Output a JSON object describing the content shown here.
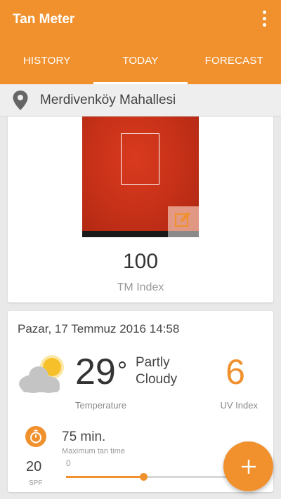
{
  "app": {
    "title": "Tan Meter"
  },
  "tabs": [
    {
      "label": "HISTORY",
      "active": false
    },
    {
      "label": "TODAY",
      "active": true
    },
    {
      "label": "FORECAST",
      "active": false
    }
  ],
  "location": {
    "name": "Merdivenköy Mahallesi",
    "icon": "location-pin-icon"
  },
  "measurement": {
    "tm_index": "100",
    "tm_index_label": "TM Index"
  },
  "weather": {
    "date": "Pazar, 17 Temmuz 2016 14:58",
    "icon": "partly-cloudy-icon",
    "temperature": "29",
    "temperature_unit": "°",
    "condition": "Partly Cloudy",
    "temperature_label": "Temperature",
    "uv_index": "6",
    "uv_label": "UV Index"
  },
  "tanning": {
    "time": "75 min.",
    "time_label": "Maximum tan time",
    "spf": "20",
    "spf_label": "SPF",
    "slider_min": "0",
    "slider_fraction": 0.46
  },
  "colors": {
    "accent": "#f0912e",
    "photo": "#c83219"
  }
}
